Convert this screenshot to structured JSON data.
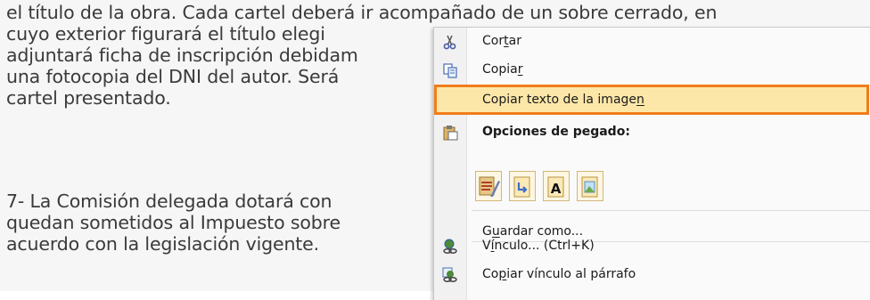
{
  "document": {
    "lines": [
      "el título de la obra. Cada cartel deberá ir acompañado de un sobre cerrado, en",
      "cuyo exterior figurará el título elegi",
      "adjuntará ficha de inscripción debidam",
      "una fotocopia del DNI del autor. Será",
      "cartel presentado.",
      "7- La Comisión delegada dotará con",
      "quedan sometidos al Impuesto sobre",
      "acuerdo con la legislación vigente."
    ]
  },
  "context_menu": {
    "cut": {
      "pre": "Cor",
      "key": "t",
      "post": "ar",
      "icon": "scissors-icon"
    },
    "copy": {
      "pre": "Copia",
      "key": "r",
      "post": "",
      "icon": "copy-icon"
    },
    "copy_image_text": {
      "pre": "Copiar texto de la image",
      "key": "n",
      "post": ""
    },
    "paste_options_header": "Opciones de pegado:",
    "paste_icons": [
      "paste-keep-formatting-icon",
      "paste-merge-formatting-icon",
      "paste-text-only-icon",
      "paste-picture-icon"
    ],
    "save_as": {
      "pre": "G",
      "key": "u",
      "post": "ardar como..."
    },
    "hyperlink": {
      "pre": "V",
      "key": "í",
      "post": "nculo... (Ctrl+K)",
      "icon": "hyperlink-icon"
    },
    "copy_link_paragraph": {
      "pre": "Co",
      "key": "p",
      "post": "iar vínculo al párrafo",
      "icon": "link-paragraph-icon"
    }
  },
  "colors": {
    "highlight_border": "#f07d1c",
    "highlight_fill": "#fde7a8"
  }
}
